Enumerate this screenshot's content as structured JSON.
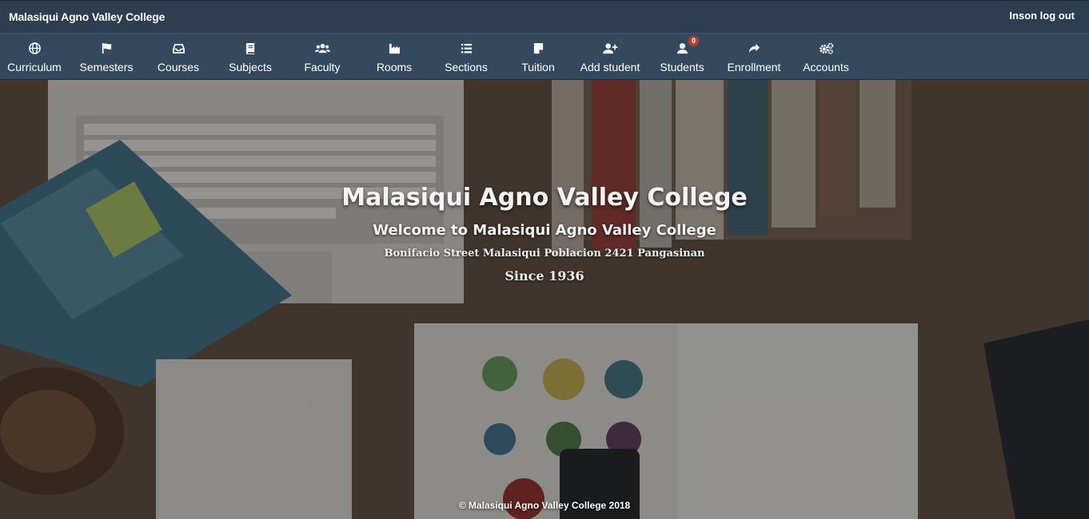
{
  "topbar": {
    "brand": "Malasiqui Agno Valley College",
    "logout": "Inson log out"
  },
  "nav": {
    "items": [
      {
        "label": "Curriculum",
        "icon": "globe-icon"
      },
      {
        "label": "Semesters",
        "icon": "flag-icon"
      },
      {
        "label": "Courses",
        "icon": "inbox-icon"
      },
      {
        "label": "Subjects",
        "icon": "book-icon"
      },
      {
        "label": "Faculty",
        "icon": "users-icon"
      },
      {
        "label": "Rooms",
        "icon": "industry-icon"
      },
      {
        "label": "Sections",
        "icon": "list-icon"
      },
      {
        "label": "Tuition",
        "icon": "sticky-note-icon"
      },
      {
        "label": "Add student",
        "icon": "user-plus-icon"
      },
      {
        "label": "Students",
        "icon": "user-icon",
        "badge": "0"
      },
      {
        "label": "Enrollment",
        "icon": "share-icon"
      },
      {
        "label": "Accounts",
        "icon": "cogs-icon"
      }
    ]
  },
  "hero": {
    "title": "Malasiqui Agno Valley College",
    "subtitle": "Welcome to Malasiqui Agno Valley College",
    "address": "Bonifacio Street Malasiqui Poblacion 2421 Pangasinan",
    "since": "Since 1936"
  },
  "footer": {
    "text": "© Malasiqui Agno Valley College 2018"
  },
  "colors": {
    "topbar": "#2c3e50",
    "navbar": "#34495e",
    "badge": "#c0392b"
  }
}
